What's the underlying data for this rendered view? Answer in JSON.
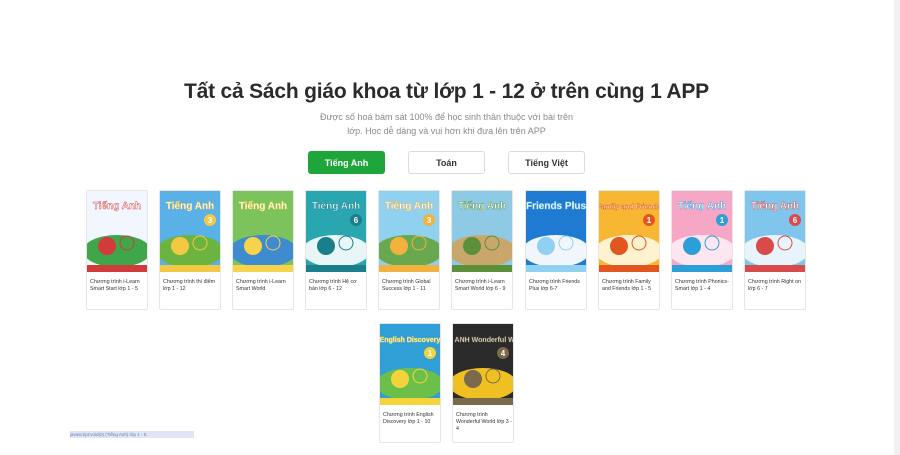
{
  "heading": "Tất cả Sách giáo khoa từ lớp 1 - 12 ở trên cùng 1 APP",
  "subheading": "Được số hoá bám sát 100% để học sinh thân thuộc với bài trên lớp. Học dễ dàng và vui hơn khi đưa lên trên APP",
  "tabs": [
    {
      "label": "Tiếng Anh",
      "active": true
    },
    {
      "label": "Toán",
      "active": false
    },
    {
      "label": "Tiếng Việt",
      "active": false
    }
  ],
  "books": [
    {
      "cover_text": "Tiếng Anh",
      "cover_num": "",
      "label": "Chương trình i-Learn Smart Start lớp 1 - 5",
      "colors": [
        "#f2f7ff",
        "#d23b3b",
        "#3fa64a"
      ]
    },
    {
      "cover_text": "Tiếng Anh",
      "cover_num": "3",
      "label": "Chương trình thí điểm lớp 1 - 12",
      "colors": [
        "#5ab1e8",
        "#f3c943",
        "#6db33f"
      ]
    },
    {
      "cover_text": "Tiếng Anh",
      "cover_num": "",
      "label": "Chương trình i-Learn Smart World",
      "colors": [
        "#7cc35c",
        "#f6d34a",
        "#3f8bcf"
      ]
    },
    {
      "cover_text": "Tiếng Anh",
      "cover_num": "6",
      "label": "Chương trình Hệ cơ bản lớp 6 - 12",
      "colors": [
        "#2aa6b1",
        "#1b7f8b",
        "#e8f6f7"
      ]
    },
    {
      "cover_text": "Tiếng Anh",
      "cover_num": "3",
      "label": "Chương trình Global Success lớp 1 - 11",
      "colors": [
        "#8fd1ef",
        "#f3b23d",
        "#6aa84f"
      ]
    },
    {
      "cover_text": "Tiếng Anh",
      "cover_num": "",
      "label": "Chương trình i-Learn Smart World lớp 6 - 9",
      "colors": [
        "#8ec9e6",
        "#5b8f3a",
        "#c9a66b"
      ]
    },
    {
      "cover_text": "Friends Plus",
      "cover_num": "",
      "label": "Chương trình Friends Plus lớp 6-7",
      "colors": [
        "#1f7bd1",
        "#8fd0f3",
        "#f0f6fb"
      ]
    },
    {
      "cover_text": "Family and Friends",
      "cover_num": "1",
      "label": "Chương trình Family and Friends lớp 1 - 5",
      "colors": [
        "#f7b733",
        "#e2561f",
        "#fff3cf"
      ]
    },
    {
      "cover_text": "Tiếng Anh",
      "cover_num": "1",
      "label": "Chương trình Phonics-Smart lớp 1 - 4",
      "colors": [
        "#f6a7c5",
        "#2d9fd8",
        "#fde6ef"
      ]
    },
    {
      "cover_text": "Tiếng Anh",
      "cover_num": "6",
      "label": "Chương trình Right on lớp 6 - 7",
      "colors": [
        "#7fc5ec",
        "#d94a4a",
        "#e8f4fb"
      ]
    },
    {
      "cover_text": "English Discovery",
      "cover_num": "1",
      "label": "Chương trình English Discovery lớp 1 - 10",
      "colors": [
        "#2f9fd6",
        "#f5d33d",
        "#6cc04a"
      ]
    },
    {
      "cover_text": "TIẾNG ANH Wonderful WORLD",
      "cover_num": "4",
      "label": "Chương trình Wonderful World lớp 3 - 4",
      "colors": [
        "#2a2a2a",
        "#7a6a4b",
        "#f0c022"
      ]
    }
  ],
  "status_text": "javascript:void(0) (Tiếng Anh) lớp 1 - 5"
}
